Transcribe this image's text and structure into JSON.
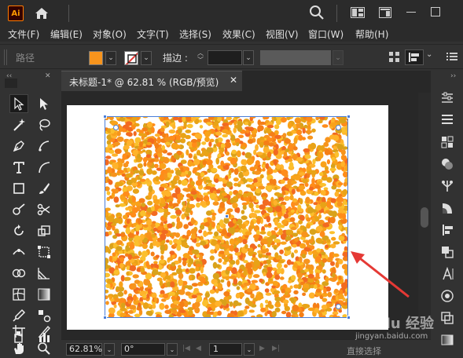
{
  "app": {
    "logo_text": "Ai"
  },
  "menu": [
    "文件(F)",
    "编辑(E)",
    "对象(O)",
    "文字(T)",
    "选择(S)",
    "效果(C)",
    "视图(V)",
    "窗口(W)",
    "帮助(H)"
  ],
  "control_bar": {
    "selection_label": "路径",
    "fill_color": "#f7941d",
    "stroke_label": "描边 :",
    "stroke_weight": ""
  },
  "document": {
    "tab_title": "未标题-1* @ 62.81 % (RGB/预览)",
    "close_glyph": "✕",
    "pattern_colors": [
      "#f7941d",
      "#f26a21",
      "#ffb32b",
      "#f9a21a",
      "#e8a317",
      "#ff8c1a",
      "#d9a21b",
      "#fbc02d",
      "#f57f17"
    ]
  },
  "status_bar": {
    "zoom": "62.81%",
    "rotation": "0°",
    "page": "1",
    "current_tool": "直接选择"
  },
  "watermark": {
    "logo": "Baidu 经验",
    "url": "jingyan.baidu.com"
  },
  "annotation": {
    "arrow_color": "#e53935"
  }
}
